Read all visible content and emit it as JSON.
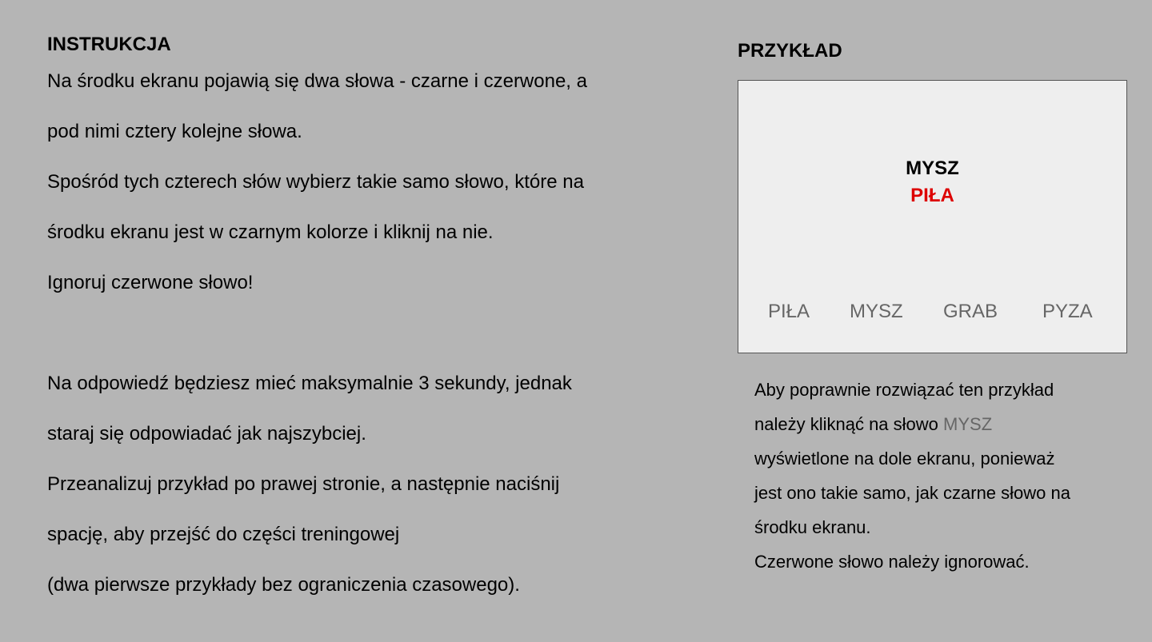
{
  "instructions": {
    "heading": "INSTRUKCJA",
    "paragraph1": [
      "Na środku ekranu pojawią się dwa słowa - czarne i czerwone, a",
      "pod nimi cztery kolejne słowa.",
      "Spośród tych czterech słów wybierz takie samo słowo, które na",
      "środku ekranu jest w czarnym kolorze i kliknij na nie.",
      "Ignoruj czerwone słowo!"
    ],
    "paragraph2": [
      "Na odpowiedź będziesz mieć maksymalnie 3 sekundy, jednak",
      "staraj się odpowiadać jak najszybciej.",
      "Przeanalizuj przykład po prawej stronie, a następnie naciśnij",
      "spację, aby przejść do części treningowej",
      "(dwa pierwsze przykłady bez ograniczenia czasowego)."
    ]
  },
  "example": {
    "heading": "PRZYKŁAD",
    "black_word": "MYSZ",
    "red_word": "PIŁA",
    "options": [
      "PIŁA",
      "MYSZ",
      "GRAB",
      "PYZA"
    ],
    "explanation": {
      "line1": "Aby poprawnie rozwiązać ten przykład",
      "line2_prefix": "należy kliknąć na słowo ",
      "line2_word": "MYSZ",
      "line3": "wyświetlone na dole ekranu, ponieważ",
      "line4": "jest ono takie samo, jak czarne słowo na",
      "line5": "środku ekranu.",
      "line6": "Czerwone słowo należy ignorować."
    }
  },
  "colors": {
    "background": "#b5b5b5",
    "box_background": "#eeeeee",
    "red_word": "#dd0000",
    "option_text": "#666666"
  }
}
